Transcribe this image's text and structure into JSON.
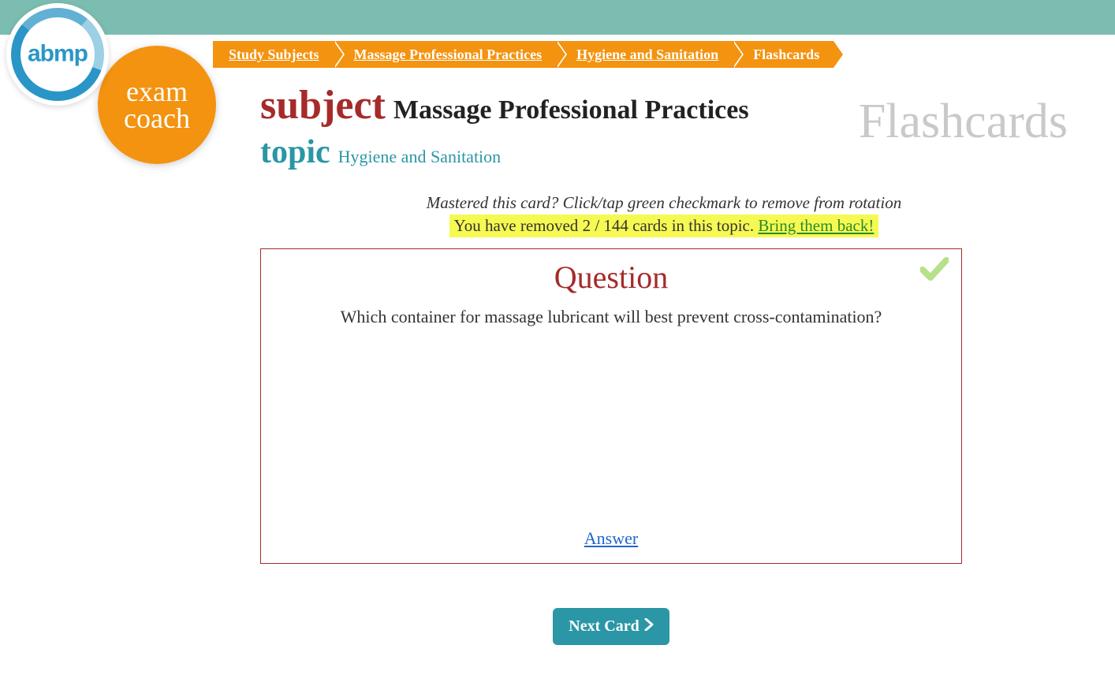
{
  "logo": {
    "abmp": "abmp",
    "exam_line1": "exam",
    "exam_line2": "coach"
  },
  "breadcrumb": {
    "items": [
      {
        "label": "Study Subjects"
      },
      {
        "label": "Massage Professional Practices"
      },
      {
        "label": "Hygiene and Sanitation"
      },
      {
        "label": "Flashcards"
      }
    ]
  },
  "page_type": "Flashcards",
  "subject": {
    "label": "subject",
    "value": "Massage Professional Practices"
  },
  "topic": {
    "label": "topic",
    "value": "Hygiene and Sanitation"
  },
  "instructions": {
    "hint": "Mastered this card? Click/tap green checkmark to remove from rotation",
    "removed_prefix": "You have removed ",
    "removed_count": "2 / 144",
    "removed_suffix": " cards in this topic. ",
    "bring_back": "Bring them back!"
  },
  "card": {
    "title": "Question",
    "question": "Which container for massage lubricant will best prevent cross-contamination?",
    "answer_link": "Answer"
  },
  "next_button": "Next Card"
}
